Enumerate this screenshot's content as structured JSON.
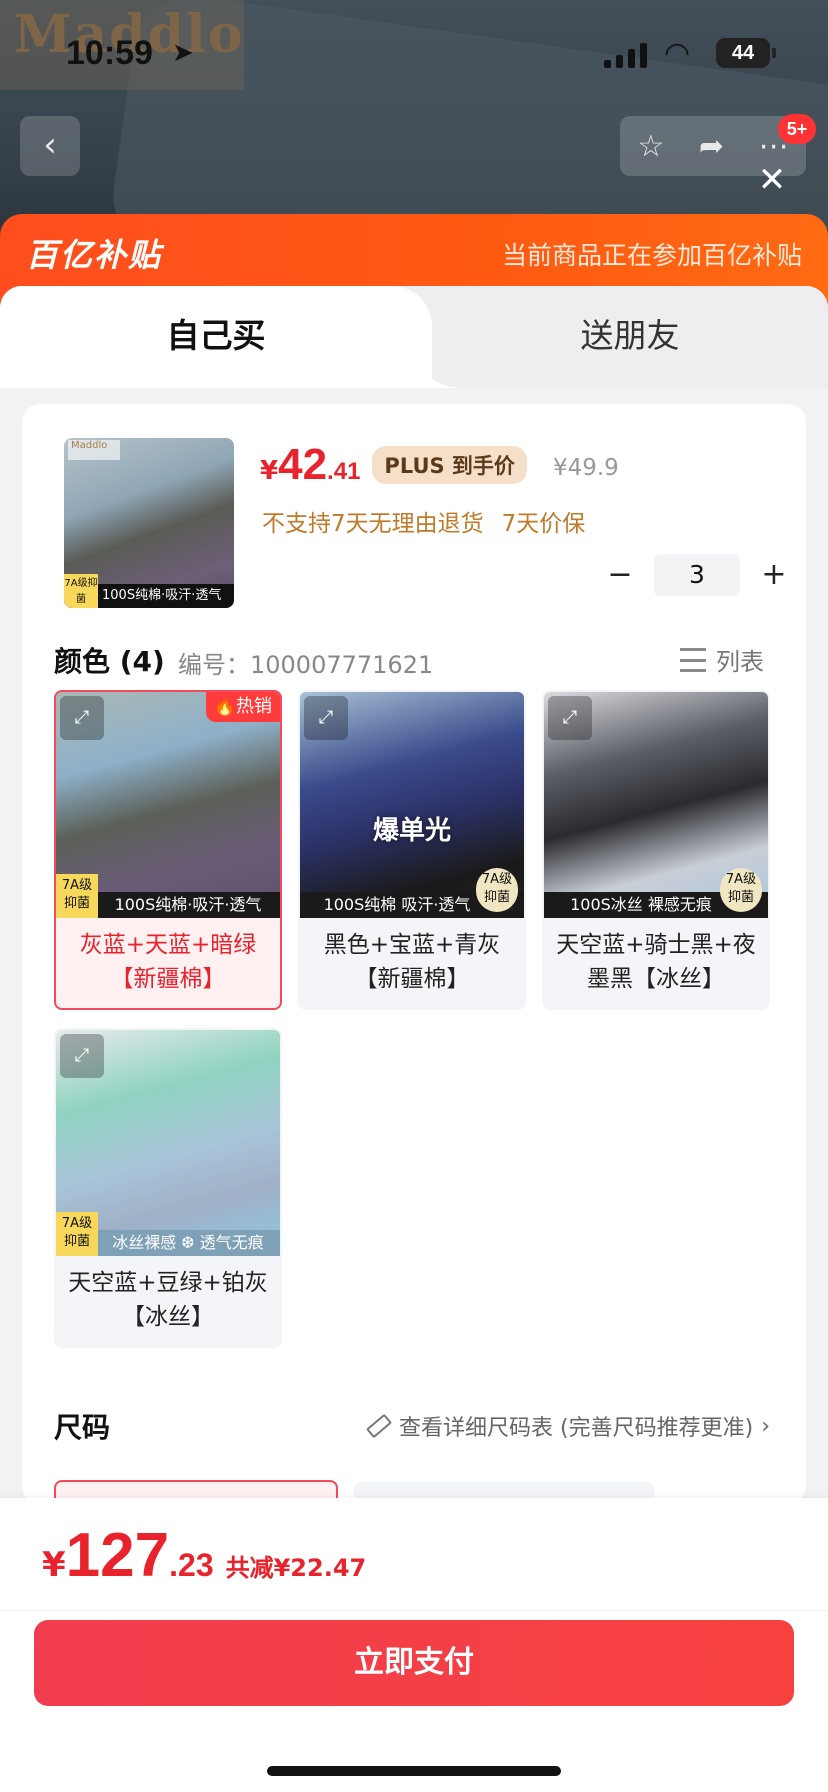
{
  "status_bar": {
    "time": "10:59",
    "battery": "44"
  },
  "background": {
    "brand_logo": "Maddlo",
    "nav_badge": "5+"
  },
  "banner": {
    "logo_text": "百亿补贴",
    "note": "当前商品正在参加百亿补贴"
  },
  "tabs": [
    {
      "label": "自己买",
      "active": true
    },
    {
      "label": "送朋友",
      "active": false
    }
  ],
  "product": {
    "thumb_caption": "100S纯棉·吸汗·透气",
    "thumb_tag": "7A级抑菌",
    "price_symbol": "¥",
    "price_int": "42",
    "price_dec": ".41",
    "plus_tag": "PLUS 到手价",
    "original_price": "¥49.9",
    "notice_return": "不支持7天无理由退货",
    "notice_price": "7天价保",
    "quantity": "3",
    "minus": "−",
    "plus": "+"
  },
  "color_section": {
    "title": "颜色 (4)",
    "code": "编号：100007771621",
    "list_toggle": "列表"
  },
  "variants": [
    {
      "label": "灰蓝+天蓝+暗绿【新疆棉】",
      "caption": "100S纯棉·吸汗·透气",
      "tag": "7A级抑菌",
      "hot": "热销",
      "selected": true
    },
    {
      "label": "黑色+宝蓝+青灰【新疆棉】",
      "caption": "100S纯棉 吸汗·透气",
      "tag": "7A级抑菌",
      "overlay": "爆单光",
      "selected": false
    },
    {
      "label": "天空蓝+骑士黑+夜墨黑【冰丝】",
      "caption": "100S冰丝 裸感无痕",
      "tag": "7A级抑菌",
      "selected": false
    },
    {
      "label": "天空蓝+豆绿+铂灰【冰丝】",
      "caption": "冰丝裸感 ❆ 透气无痕",
      "tag": "7A级抑菌",
      "selected": false
    }
  ],
  "size_section": {
    "title": "尺码",
    "link": "查看详细尺码表 (完善尺码推荐更准)"
  },
  "footer": {
    "total_symbol": "¥",
    "total_int": "127",
    "total_dec": ".23",
    "saved": "共减¥22.47",
    "pay_button": "立即支付"
  },
  "colors": {
    "accent": "#e8232b",
    "banner": "#ff5a12",
    "pay": "#f23d4f"
  }
}
